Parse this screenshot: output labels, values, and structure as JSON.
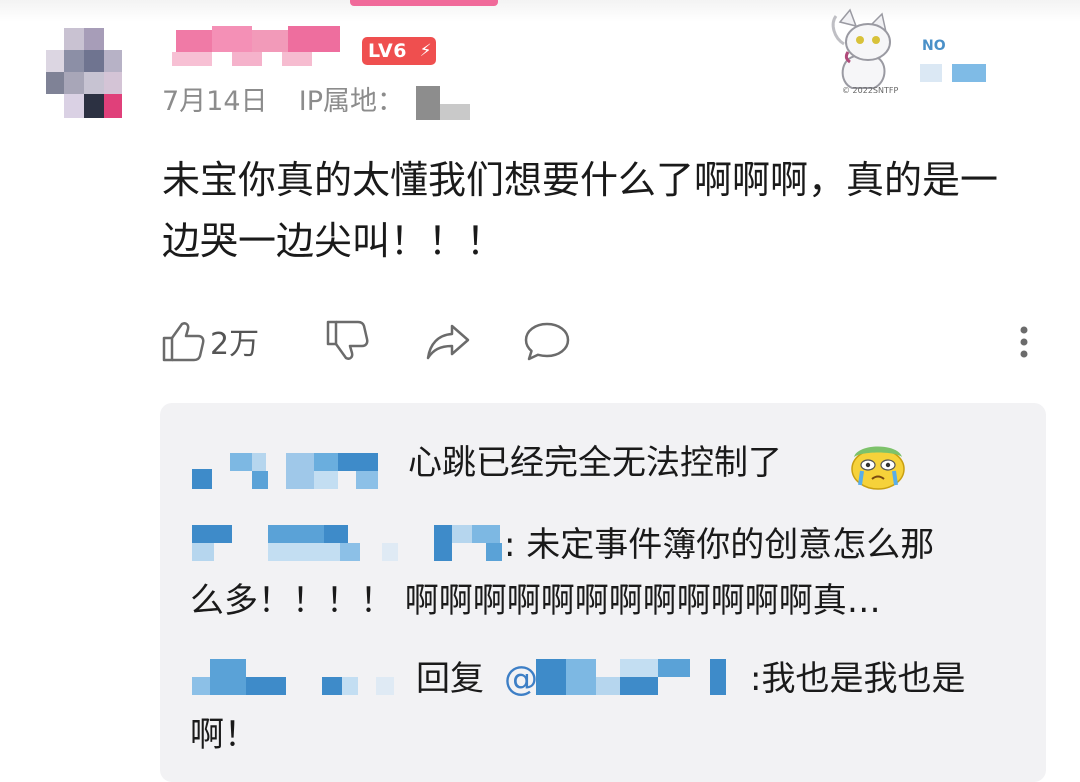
{
  "comment": {
    "level_badge": "LV6",
    "date": "7月14日",
    "ip_label": "IP属地：",
    "pendant_copyright": "© 2022SNTFP",
    "text": "未宝你真的太懂我们想要什么了啊啊啊，真的是一边哭一边尖叫！！！",
    "like_count": "2万"
  },
  "actions": {
    "icons": [
      "thumbs-up-icon",
      "thumbs-down-icon",
      "share-icon",
      "reply-icon",
      "more-icon"
    ]
  },
  "replies": [
    {
      "text": "心跳已经完全无法控制了"
    },
    {
      "line1": ": 未定事件簿你的创意怎么那",
      "line2": "么多！！！！ 啊啊啊啊啊啊啊啊啊啊啊啊真…"
    },
    {
      "reply_word": "回复",
      "mention_at": "@",
      "line1_tail": ":我也是我也是",
      "line2": "啊！"
    }
  ],
  "colors": {
    "accent_pink": "#f06a9a",
    "level_red": "#ef4f4f",
    "mention_blue": "#3d7fc6",
    "reply_bg": "#f2f2f4"
  }
}
